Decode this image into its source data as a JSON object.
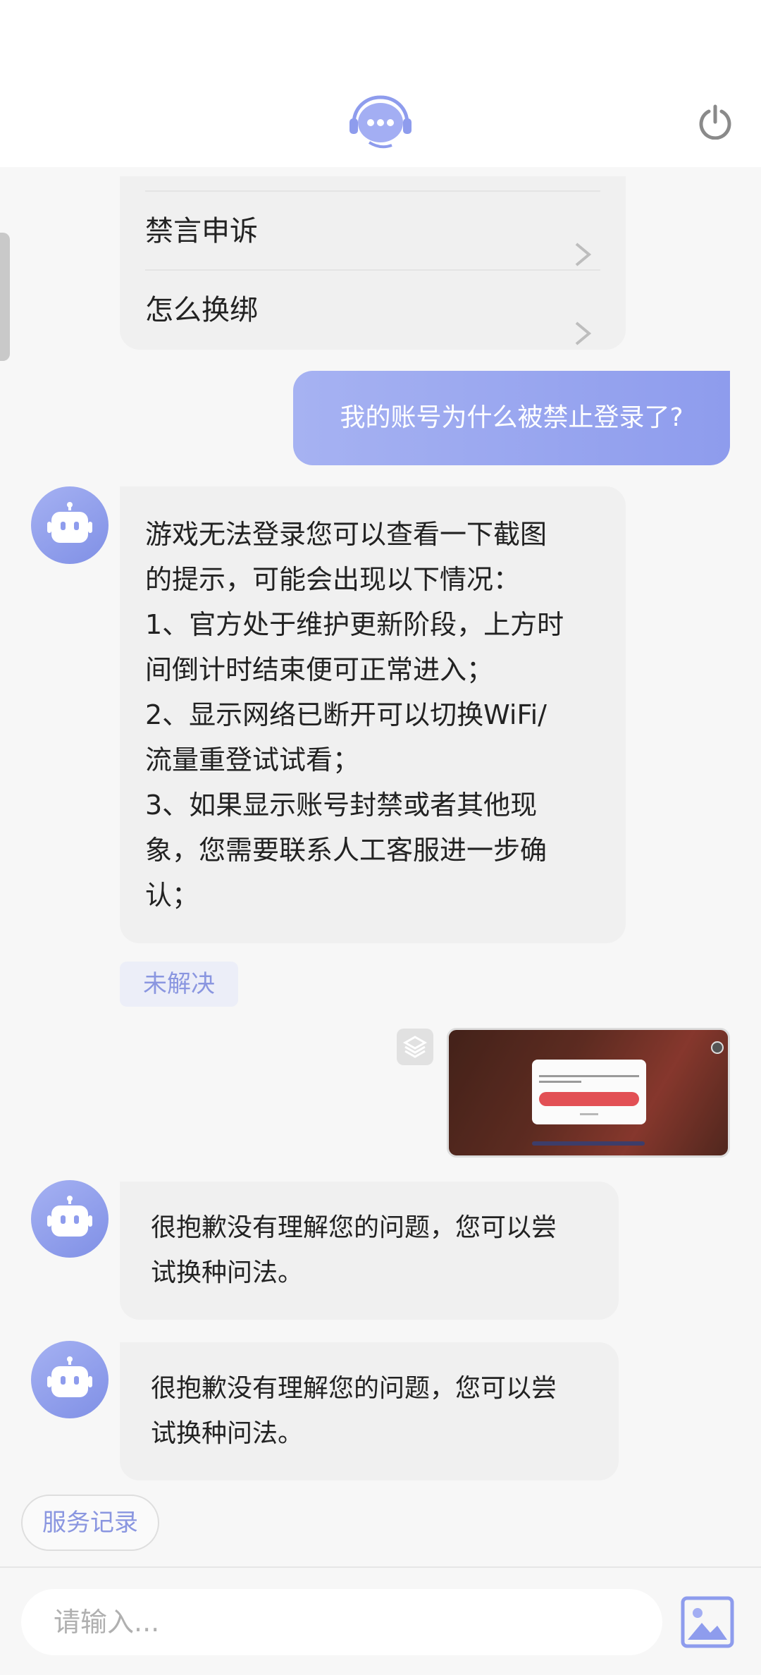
{
  "faq": {
    "items": [
      {
        "label": "禁言申诉"
      },
      {
        "label": "怎么换绑"
      }
    ]
  },
  "user_message": "我的账号为什么被禁止登录了?",
  "bot_long_message": {
    "lines": [
      "游戏无法登录您可以查看一下截图",
      "的提示，可能会出现以下情况：",
      "1、官方处于维护更新阶段，上方时",
      "间倒计时结束便可正常进入；",
      "2、显示网络已断开可以切换WiFi/",
      "流量重登试试看；",
      "3、如果显示账号封禁或者其他现",
      "象，您需要联系人工客服进一步确",
      "认；"
    ]
  },
  "unsolved_label": "未解决",
  "bot_reply_1": {
    "line1": "很抱歉没有理解您的问题，您可以尝",
    "line2": "试换种问法。"
  },
  "bot_reply_2": {
    "line1": "很抱歉没有理解您的问题，您可以尝",
    "line2": "试换种问法。"
  },
  "service_records_label": "服务记录",
  "input": {
    "placeholder": "请输入..."
  },
  "colors": {
    "accent": "#8e9ced",
    "accent_text": "#8a96e0",
    "bubble_bg": "#f0f0f0",
    "page_bg": "#f7f7f7"
  },
  "icons": {
    "logo": "chat-bubble-headset-icon",
    "power": "power-icon",
    "chevron": "chevron-right-icon",
    "avatar": "robot-icon",
    "layers": "layers-icon",
    "image": "image-icon"
  }
}
